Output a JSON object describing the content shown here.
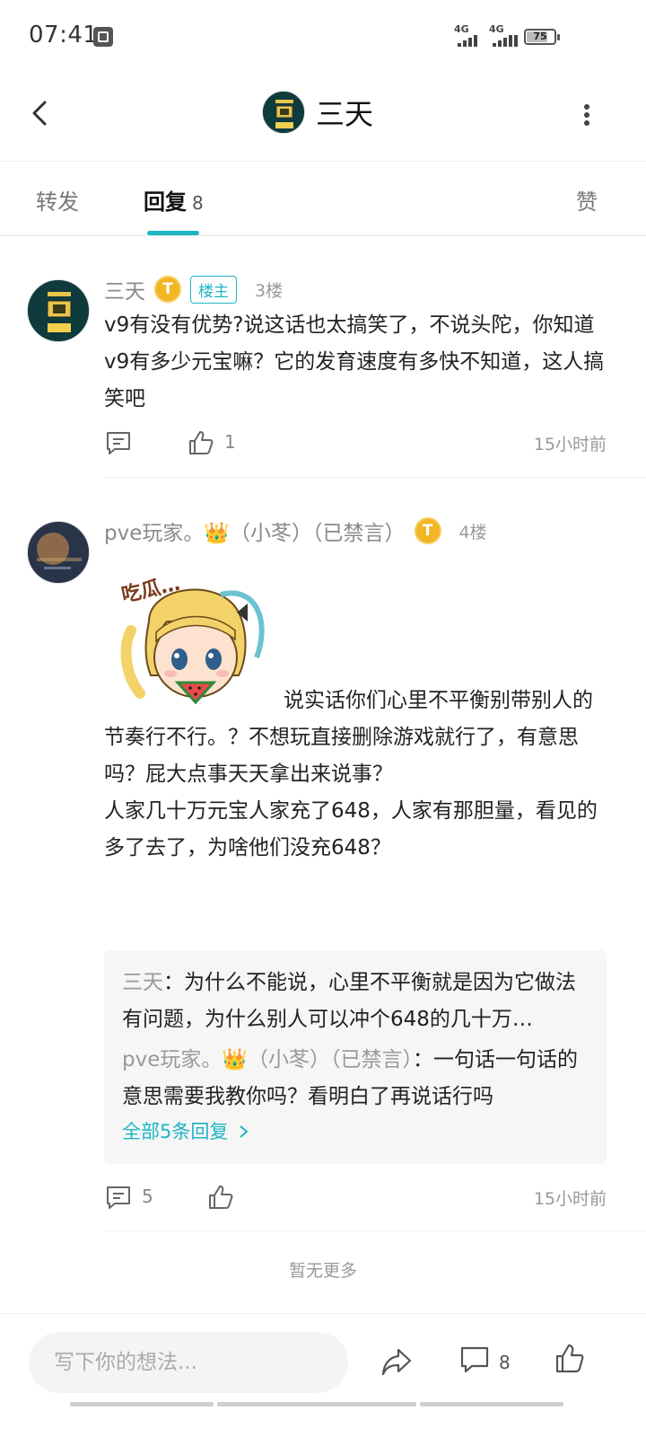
{
  "status_bar": {
    "time": "07:41",
    "network_left": "4G",
    "network_right": "4G",
    "battery": "75",
    "battery_level": 0.75
  },
  "header": {
    "title": "三天",
    "icons": [
      "back-icon",
      "more-vertical-icon"
    ]
  },
  "tabs": {
    "forward": "转发",
    "reply": "回复",
    "reply_count": "8",
    "like": "赞",
    "active": "reply"
  },
  "posts": [
    {
      "name": "三天",
      "badge": "T",
      "host_label": "楼主",
      "floor": "3楼",
      "content": "v9有没有优势?说这话也太搞笑了，不说头陀，你知道v9有多少元宝嘛？它的发育速度有多快不知道，这人搞笑吧",
      "comments": "",
      "likes": "1",
      "time": "15小时前"
    },
    {
      "name": "pve玩家。👑（小苳）（已禁言）",
      "badge": "T",
      "floor": "4楼",
      "sticker_text": "吃瓜…",
      "content": "说实话你们心里不平衡别带别人的节奏行不行。？不想玩直接删除游戏就行了，有意思吗？屁大点事天天拿出来说事？\n人家几十万元宝人家充了648，人家有那胆量，看见的多了去了，为啥他们没充648？",
      "replies": [
        {
          "name": "三天",
          "sep": "：",
          "text": "为什么不能说，心里不平衡就是因为它做法有问题，为什么别人可以冲个648的几十万…"
        },
        {
          "name": "pve玩家。👑（小苳）（已禁言）",
          "sep": "：",
          "text": "一句话一句话的意思需要我教你吗？看明白了再说话行吗"
        }
      ],
      "all_replies": "全部5条回复",
      "comments": "5",
      "likes": "",
      "time": "15小时前"
    }
  ],
  "footer_note": "暂无更多",
  "bottom_bar": {
    "placeholder": "写下你的想法...",
    "comment_count": "8"
  },
  "colors": {
    "accent": "#1cb5c5",
    "badge": "#f2b524"
  }
}
